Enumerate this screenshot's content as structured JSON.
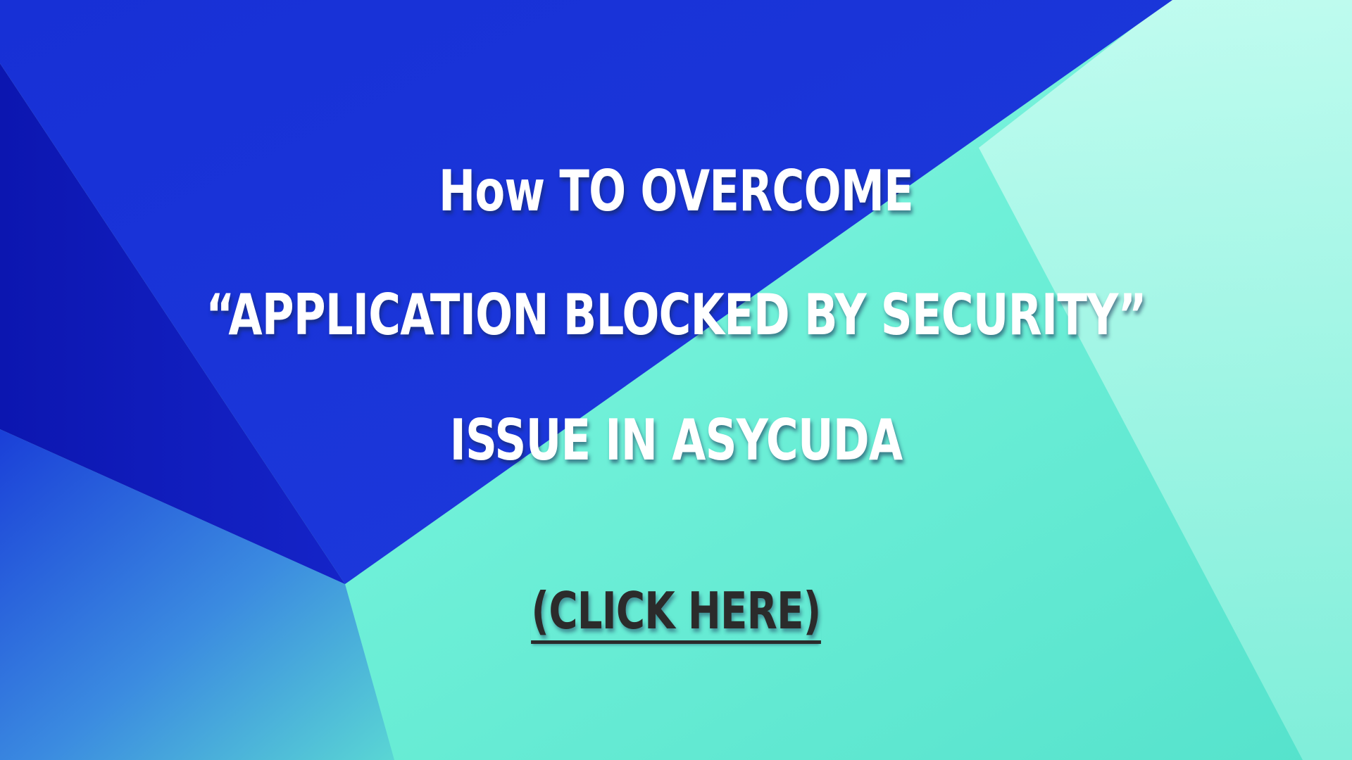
{
  "headline": {
    "line_1": "How TO OVERCOME",
    "line_2": "“APPLICATION BLOCKED BY SECURITY”",
    "line_3": "ISSUE IN ASYCUDA"
  },
  "cta": {
    "label": "(CLICK HERE)"
  },
  "colors": {
    "deep_blue": "#1a2fd6",
    "dark_blue": "#1018b8",
    "aqua": "#5fe6cf",
    "mint": "#c8fbf0",
    "headline_text": "#ffffff",
    "cta_text": "#2b2b2b"
  }
}
